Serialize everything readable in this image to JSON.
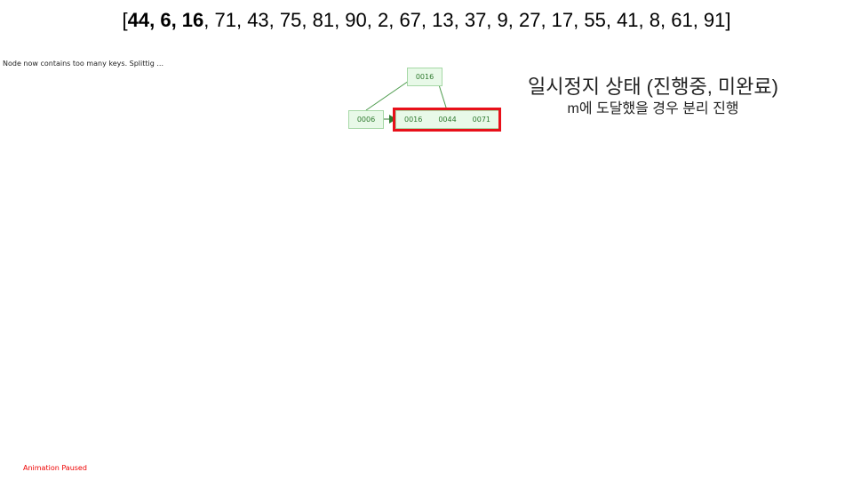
{
  "sequence": {
    "bold_items": [
      "44",
      "6",
      "16"
    ],
    "rest": ", 71, 43, 75, 81, 90, 2, 67, 13, 37, 9, 27, 17, 55, 41, 8, 61, 91]"
  },
  "status_message": "Node now contains too many keys.  Splittig ...",
  "animation_status": "Animation Paused",
  "tree": {
    "root": {
      "keys": [
        "0016"
      ]
    },
    "left": {
      "keys": [
        "0006"
      ]
    },
    "right": {
      "keys": [
        "0016",
        "0044",
        "0071"
      ]
    }
  },
  "annotation": {
    "title": "일시정지 상태 (진행중, 미완료)",
    "subtitle": "m에 도달했을 경우 분리 진행"
  },
  "colors": {
    "highlight": "#e8101a",
    "node_fill": "#e8f9e8",
    "node_text": "#2f7a2f",
    "paused": "#ee0000"
  }
}
